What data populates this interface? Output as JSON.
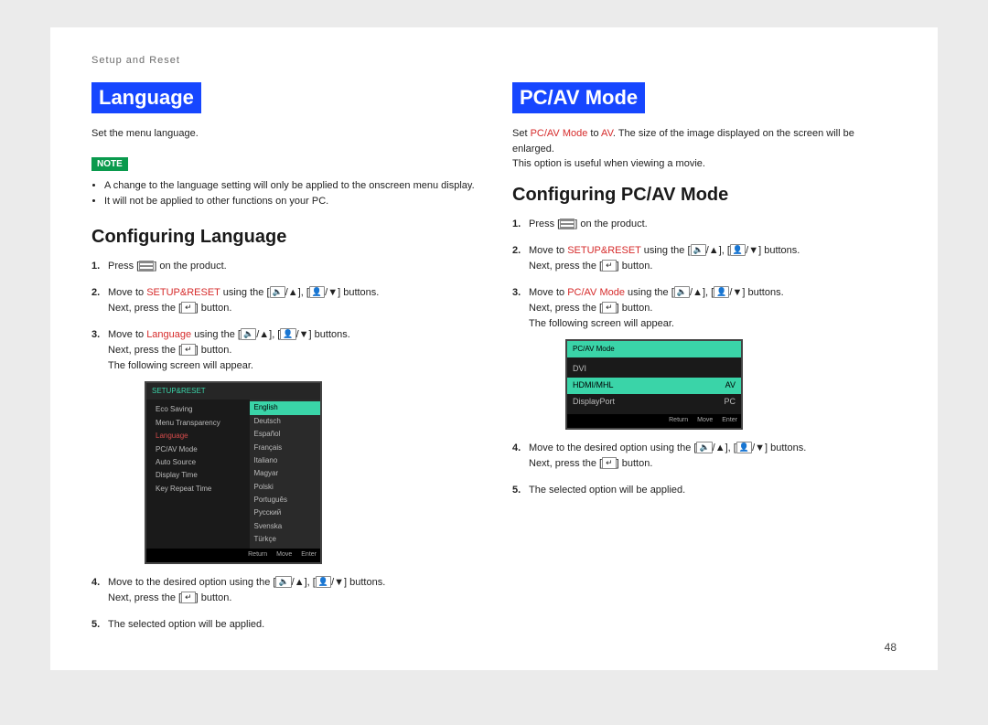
{
  "header": {
    "breadcrumb": "Setup and Reset"
  },
  "page_number": "48",
  "left": {
    "title": "Language",
    "intro": "Set the menu language.",
    "note_label": "NOTE",
    "notes": [
      "A change to the language setting will only be applied to the onscreen menu display.",
      "It will not be applied to other functions on your PC."
    ],
    "subheading": "Configuring Language",
    "steps": {
      "s1": "Press [",
      "s1b": "] on the product.",
      "s2a": "Move to ",
      "s2_accent": "SETUP&RESET",
      "s2b": " using the [",
      "s2c": "], [",
      "s2d": "] buttons.",
      "next_press": "Next, press the [",
      "next_press_end": "] button.",
      "s3a": "Move to ",
      "s3_accent": "Language",
      "s3b": " using the [",
      "s3c": "], [",
      "s3d": "] buttons.",
      "following": "The following screen will appear.",
      "s4a": "Move to the desired option using the [",
      "s4b": "], [",
      "s4c": "] buttons.",
      "s5": "The selected option will be applied."
    },
    "osd": {
      "header": "SETUP&RESET",
      "left_items": [
        "Eco Saving",
        "Menu Transparency",
        "Language",
        "PC/AV Mode",
        "Auto Source",
        "Display Time",
        "Key Repeat Time"
      ],
      "selected_left_index": 2,
      "right_opts": [
        "English",
        "Deutsch",
        "Español",
        "Français",
        "Italiano",
        "Magyar",
        "Polski",
        "Português",
        "Русский",
        "Svenska",
        "Türkçe"
      ],
      "highlight_right_index": 0,
      "footer": [
        "Return",
        "Move",
        "Enter"
      ]
    }
  },
  "right": {
    "title": "PC/AV Mode",
    "intro_a": "Set ",
    "intro_accent1": "PC/AV Mode",
    "intro_b": " to ",
    "intro_accent2": "AV",
    "intro_c": ". The size of the image displayed on the screen will be enlarged.",
    "intro_line2": "This option is useful when viewing a movie.",
    "subheading": "Configuring PC/AV Mode",
    "steps": {
      "s1": "Press [",
      "s1b": "] on the product.",
      "s2a": "Move to ",
      "s2_accent": "SETUP&RESET",
      "s2b": " using the [",
      "s2c": "], [",
      "s2d": "] buttons.",
      "next_press": "Next, press the [",
      "next_press_end": "] button.",
      "s3a": "Move to ",
      "s3_accent": "PC/AV Mode",
      "s3b": " using the [",
      "s3c": "], [",
      "s3d": "] buttons.",
      "following": "The following screen will appear.",
      "s4a": "Move to the desired option using the [",
      "s4b": "], [",
      "s4c": "] buttons.",
      "s5": "The selected option will be applied."
    },
    "osd": {
      "header": "PC/AV Mode",
      "rows": [
        {
          "label": "DVI",
          "value": ""
        },
        {
          "label": "HDMI/MHL",
          "value": "AV"
        },
        {
          "label": "DisplayPort",
          "value": "PC"
        }
      ],
      "highlight_index": 1,
      "footer": [
        "Return",
        "Move",
        "Enter"
      ]
    }
  }
}
